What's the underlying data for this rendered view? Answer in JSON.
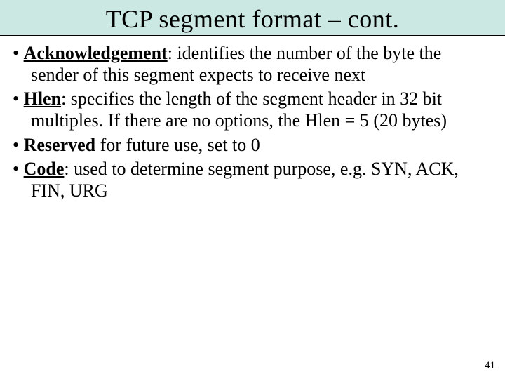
{
  "title": "TCP segment format – cont.",
  "bullets": [
    {
      "term": "Acknowledgement",
      "rest": ": identifies the number of the byte the sender of this segment expects to receive next"
    },
    {
      "term": "Hlen",
      "rest": ": specifies the length of the segment header in 32 bit multiples. If there are no options, the Hlen = 5 (20 bytes)"
    },
    {
      "term": "Reserved",
      "rest": " for future use, set to 0"
    },
    {
      "term": "Code",
      "rest": ": used to determine segment purpose, e.g. SYN, ACK, FIN, URG"
    }
  ],
  "page_number": "41"
}
